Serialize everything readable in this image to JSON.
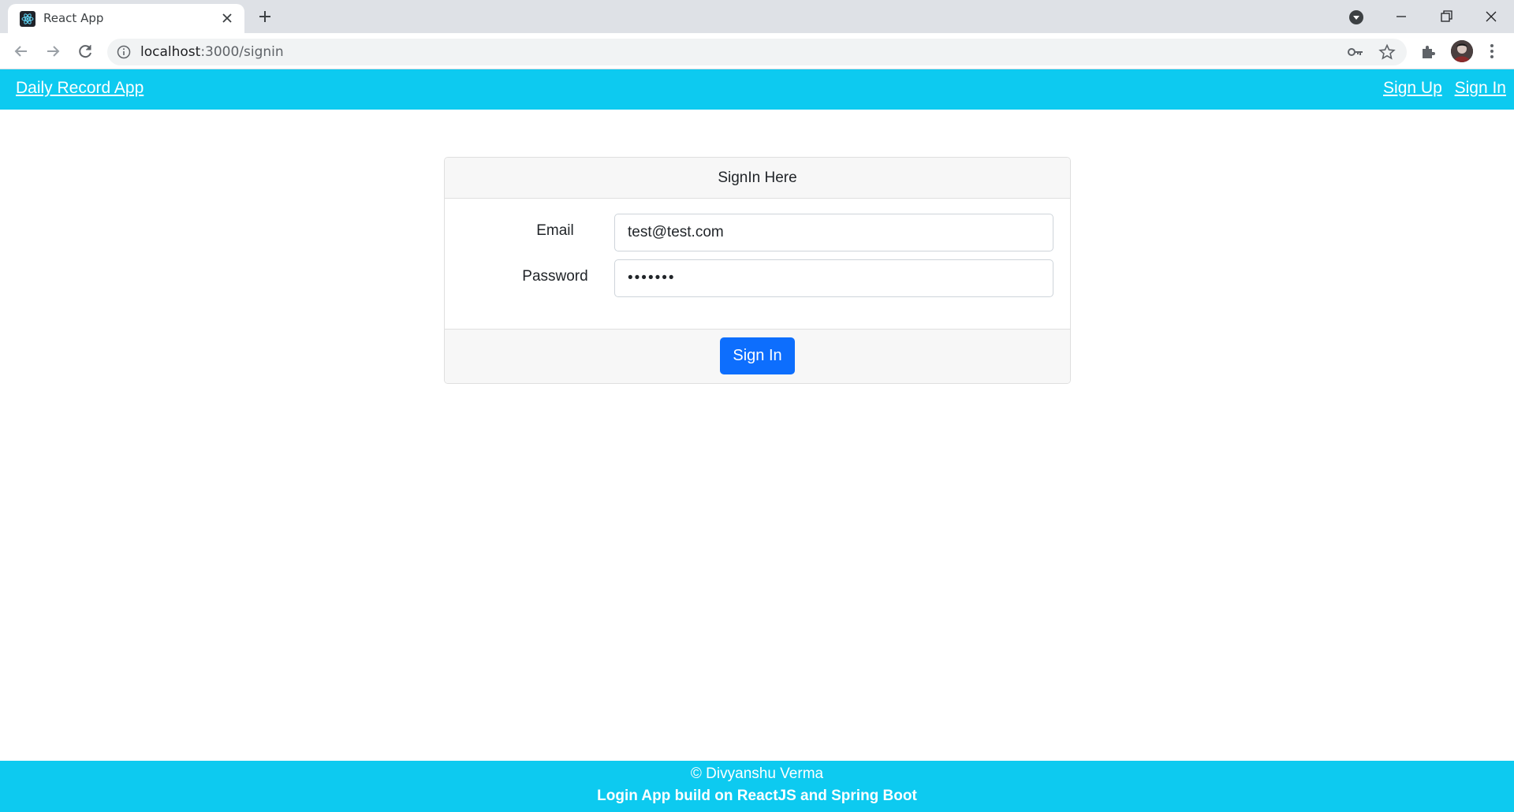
{
  "browser": {
    "tab_title": "React App",
    "url_host": "localhost",
    "url_path": ":3000/signin",
    "icons": [
      "react-favicon-icon",
      "close-icon",
      "plus-icon",
      "profile-dropdown-icon",
      "minimize-icon",
      "restore-icon",
      "close-window-icon",
      "back-icon",
      "forward-icon",
      "reload-icon",
      "info-icon",
      "key-icon",
      "star-icon",
      "puzzle-icon",
      "kebab-menu-icon"
    ]
  },
  "navbar": {
    "brand": "Daily Record App",
    "links": [
      "Sign Up",
      "Sign In"
    ],
    "color": "#0dcaf0"
  },
  "signin": {
    "header": "SignIn Here",
    "email_label": "Email",
    "email_value": "test@test.com",
    "password_label": "Password",
    "password_value": "•••••••",
    "submit_label": "Sign In",
    "button_color": "#0d6efd"
  },
  "footer": {
    "copyright": "© Divyanshu Verma",
    "tagline": "Login App build on ReactJS and Spring Boot"
  }
}
